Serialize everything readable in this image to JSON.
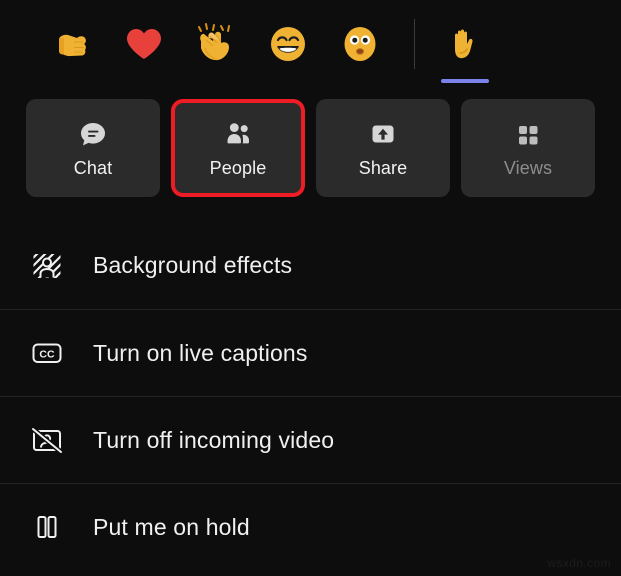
{
  "theme": {
    "background": "#0d0d0d",
    "tile_background": "#2b2b2b",
    "highlight_border": "#ee1c25",
    "accent_underline": "#7b83eb",
    "text": "#f2f2f2",
    "text_dimmed": "#8d8d8d",
    "divider": "#232323"
  },
  "reactions": {
    "items": [
      {
        "name": "thumbs-up",
        "label": "Like",
        "active": false
      },
      {
        "name": "heart",
        "label": "Heart",
        "active": false
      },
      {
        "name": "clapping-hands",
        "label": "Applause",
        "active": false
      },
      {
        "name": "laughing-face",
        "label": "Laugh",
        "active": false
      },
      {
        "name": "surprised-face",
        "label": "Surprised",
        "active": false
      },
      {
        "name": "raised-hand",
        "label": "Raise hand",
        "active": true
      }
    ]
  },
  "tiles": [
    {
      "label": "Chat",
      "icon": "chat-icon",
      "state": "enabled"
    },
    {
      "label": "People",
      "icon": "people-icon",
      "state": "highlighted"
    },
    {
      "label": "Share",
      "icon": "share-icon",
      "state": "enabled"
    },
    {
      "label": "Views",
      "icon": "views-icon",
      "state": "dimmed"
    }
  ],
  "menu": {
    "items": [
      {
        "label": "Background effects",
        "icon": "background-effects-icon"
      },
      {
        "label": "Turn on live captions",
        "icon": "closed-captions-icon"
      },
      {
        "label": "Turn off incoming video",
        "icon": "video-off-icon"
      },
      {
        "label": "Put me on hold",
        "icon": "pause-icon"
      }
    ]
  },
  "watermark": {
    "text": "wsxdn.com"
  }
}
